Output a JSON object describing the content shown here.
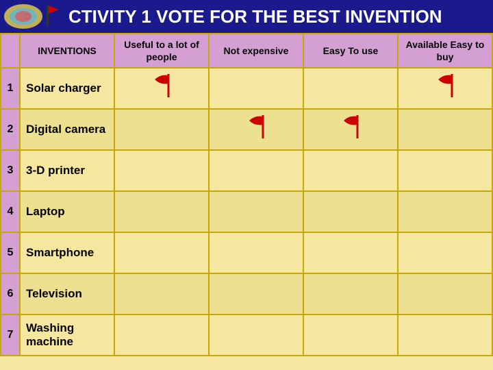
{
  "header": {
    "title": "CTIVITY 1 VOTE FOR THE BEST INVENTION"
  },
  "table": {
    "columns": [
      {
        "id": "num",
        "label": ""
      },
      {
        "id": "inventions",
        "label": "INVENTIONS"
      },
      {
        "id": "useful",
        "label": "Useful to a lot of people"
      },
      {
        "id": "notExpensive",
        "label": "Not expensive"
      },
      {
        "id": "easyToUse",
        "label": "Easy To use"
      },
      {
        "id": "available",
        "label": "Available Easy to buy"
      }
    ],
    "rows": [
      {
        "num": "1",
        "name": "Solar charger",
        "flags": [
          false,
          true,
          false,
          false,
          true
        ]
      },
      {
        "num": "2",
        "name": "Digital camera",
        "flags": [
          true,
          false,
          true,
          true,
          false
        ]
      },
      {
        "num": "3",
        "name": "3-D printer",
        "flags": [
          false,
          false,
          false,
          false,
          false
        ]
      },
      {
        "num": "4",
        "name": "Laptop",
        "flags": [
          false,
          false,
          false,
          false,
          false
        ]
      },
      {
        "num": "5",
        "name": "Smartphone",
        "flags": [
          false,
          false,
          false,
          false,
          false
        ]
      },
      {
        "num": "6",
        "name": "Television",
        "flags": [
          false,
          false,
          false,
          false,
          false
        ]
      },
      {
        "num": "7",
        "name": "Washing machine",
        "flags": [
          false,
          false,
          false,
          false,
          false
        ]
      }
    ],
    "flag_symbol": "⚑"
  },
  "colors": {
    "header_bg": "#1a1a8c",
    "table_header_bg": "#d4a0d4",
    "row_odd": "#f5e6a0",
    "row_even": "#ede090",
    "flag_color": "#cc0000",
    "border_color": "#c8a800"
  }
}
